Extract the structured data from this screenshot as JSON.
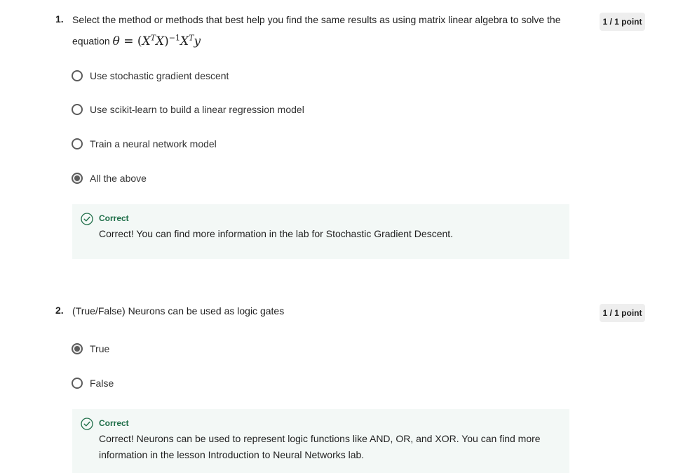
{
  "questions": [
    {
      "number": "1.",
      "text": "Select the method or methods that best help you find the same results as using matrix linear algebra to solve the equation",
      "equation": {
        "theta": "θ",
        "equals": " = ",
        "lparen": "(",
        "X1": "X",
        "T1": "T",
        "X2": "X",
        "rparen": ")",
        "inv": "−1",
        "X3": "X",
        "T2": "T",
        "y": "y"
      },
      "points": "1 / 1 point",
      "options": [
        {
          "label": "Use stochastic gradient descent",
          "selected": false
        },
        {
          "label": "Use scikit-learn to build a linear regression model",
          "selected": false
        },
        {
          "label": "Train a neural network model",
          "selected": false
        },
        {
          "label": "All the above",
          "selected": true
        }
      ],
      "feedback": {
        "status": "Correct",
        "message": "Correct! You can find more information in the lab for Stochastic Gradient Descent."
      }
    },
    {
      "number": "2.",
      "text": "(True/False) Neurons can be used as logic gates",
      "points": "1 / 1 point",
      "options": [
        {
          "label": "True",
          "selected": true
        },
        {
          "label": "False",
          "selected": false
        }
      ],
      "feedback": {
        "status": "Correct",
        "message": "Correct! Neurons can be used to represent logic functions like AND, OR, and XOR.  You can find more information in the lesson Introduction to Neural Networks lab."
      }
    }
  ],
  "colors": {
    "correct": "#1e6e48",
    "feedback_bg": "#f3f8f6",
    "points_bg": "#eeeeee"
  },
  "icons": {
    "feedback": "check-circle-icon"
  }
}
